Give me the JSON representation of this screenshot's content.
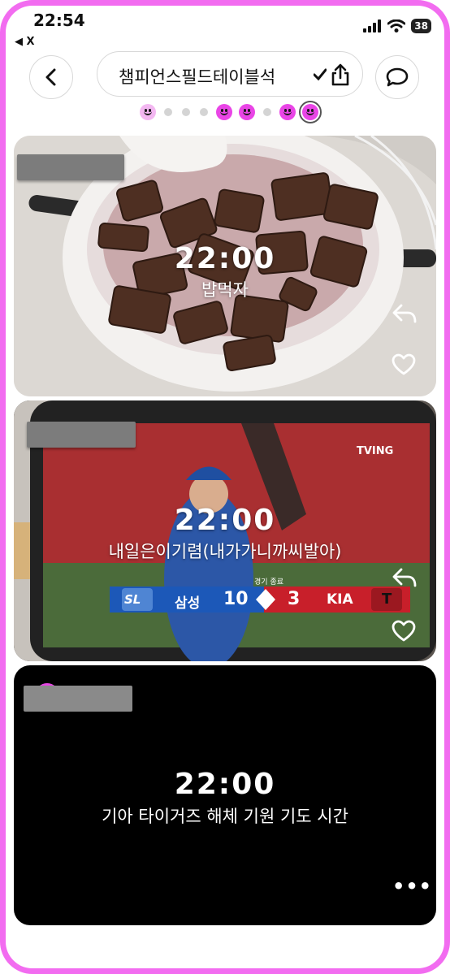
{
  "status_bar": {
    "time": "22:54",
    "back_app": "◀ X",
    "battery": "38",
    "icons": [
      "signal-icon",
      "wifi-icon",
      "battery-icon"
    ]
  },
  "header": {
    "title": "챔피언스필드테이블석",
    "back_icon": "chevron-left-icon",
    "check_icon": "checkmark-icon",
    "share_icon": "share-icon",
    "chat_icon": "speech-bubble-icon"
  },
  "pager": {
    "pattern": [
      "smiley-faded",
      "dot",
      "dot",
      "dot",
      "smiley",
      "smiley",
      "dot",
      "smiley",
      "smiley-active"
    ]
  },
  "cards": [
    {
      "time": "22:00",
      "caption": "밥먹자",
      "icons": [
        "reply-icon",
        "heart-icon"
      ]
    },
    {
      "time": "22:00",
      "caption": "내일은이기렴(내가가니까씨발아)",
      "icons": [
        "reply-icon",
        "heart-icon"
      ],
      "scoreboard": {
        "home_logo": "SL",
        "home_team": "삼성",
        "home_score": "10",
        "away_score": "3",
        "away_team": "KIA",
        "away_logo": "T",
        "status": "경기 종료",
        "broadcaster": "TVING"
      }
    },
    {
      "time": "22:00",
      "caption": "기아 타이거즈 해체 기원 기도 시간",
      "more_label": "•••"
    }
  ],
  "colors": {
    "frame": "#f26cf0",
    "accent": "#e945e6",
    "card_dark": "#000000"
  }
}
